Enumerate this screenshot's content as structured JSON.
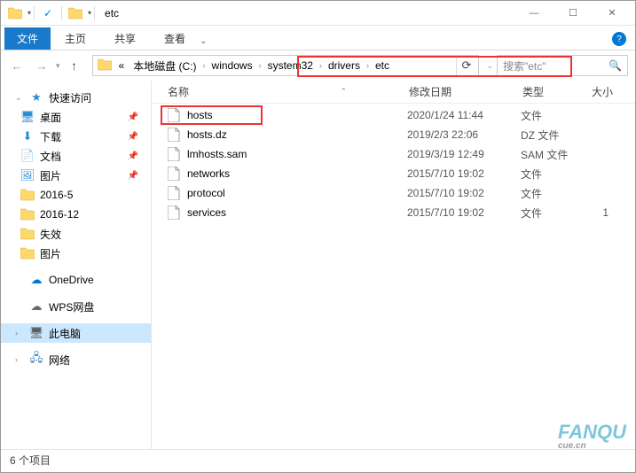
{
  "title": "etc",
  "ribbon": {
    "file": "文件",
    "home": "主页",
    "share": "共享",
    "view": "查看"
  },
  "breadcrumb": {
    "prefix": "«",
    "root": "本地磁盘 (C:)",
    "p1": "windows",
    "p2": "system32",
    "p3": "drivers",
    "p4": "etc"
  },
  "search": {
    "placeholder": "搜索\"etc\""
  },
  "sidebar": {
    "quick": "快速访问",
    "desktop": "桌面",
    "download": "下载",
    "docs": "文档",
    "pics": "图片",
    "f1": "2016-5",
    "f2": "2016-12",
    "f3": "失效",
    "f4": "图片",
    "onedrive": "OneDrive",
    "wps": "WPS网盘",
    "thispc": "此电脑",
    "network": "网络"
  },
  "columns": {
    "name": "名称",
    "date": "修改日期",
    "type": "类型",
    "size": "大小"
  },
  "files": [
    {
      "name": "hosts",
      "date": "2020/1/24 11:44",
      "type": "文件",
      "size": ""
    },
    {
      "name": "hosts.dz",
      "date": "2019/2/3 22:06",
      "type": "DZ 文件",
      "size": ""
    },
    {
      "name": "lmhosts.sam",
      "date": "2019/3/19 12:49",
      "type": "SAM 文件",
      "size": ""
    },
    {
      "name": "networks",
      "date": "2015/7/10 19:02",
      "type": "文件",
      "size": ""
    },
    {
      "name": "protocol",
      "date": "2015/7/10 19:02",
      "type": "文件",
      "size": ""
    },
    {
      "name": "services",
      "date": "2015/7/10 19:02",
      "type": "文件",
      "size": "1"
    }
  ],
  "status": "6 个项目",
  "watermark": {
    "main": "FANQU",
    "sub": "cue.cn"
  }
}
